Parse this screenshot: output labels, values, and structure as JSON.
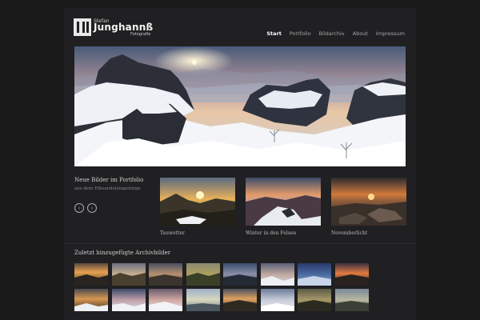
{
  "header": {
    "logo_first": "Stefan",
    "logo_last": "Junghannß",
    "logo_sub": "Fotografie"
  },
  "nav": [
    {
      "label": "Start",
      "active": true
    },
    {
      "label": "Portfolio",
      "active": false
    },
    {
      "label": "Bildarchiv",
      "active": false
    },
    {
      "label": "About",
      "active": false
    },
    {
      "label": "Impressum",
      "active": false
    }
  ],
  "slider": {
    "total_slides": 5,
    "active_index": 0
  },
  "portfolio_news": {
    "title": "Neue Bilder im Portfolio",
    "subtitle": "aus dem Elbsandsteingebirge",
    "prev_arrow": "‹",
    "next_arrow": "›",
    "items": [
      {
        "caption": "Tauwetter"
      },
      {
        "caption": "Winter in den Felsen"
      },
      {
        "caption": "Novemberlicht"
      }
    ]
  },
  "archive": {
    "title": "Zuletzt hinzugefügte Archivbilder",
    "thumb_count": 16
  },
  "colors": {
    "background": "#1a1a1b",
    "panel": "#202022",
    "nav_active": "#ffffff",
    "nav_inactive": "#a8a8a8"
  }
}
